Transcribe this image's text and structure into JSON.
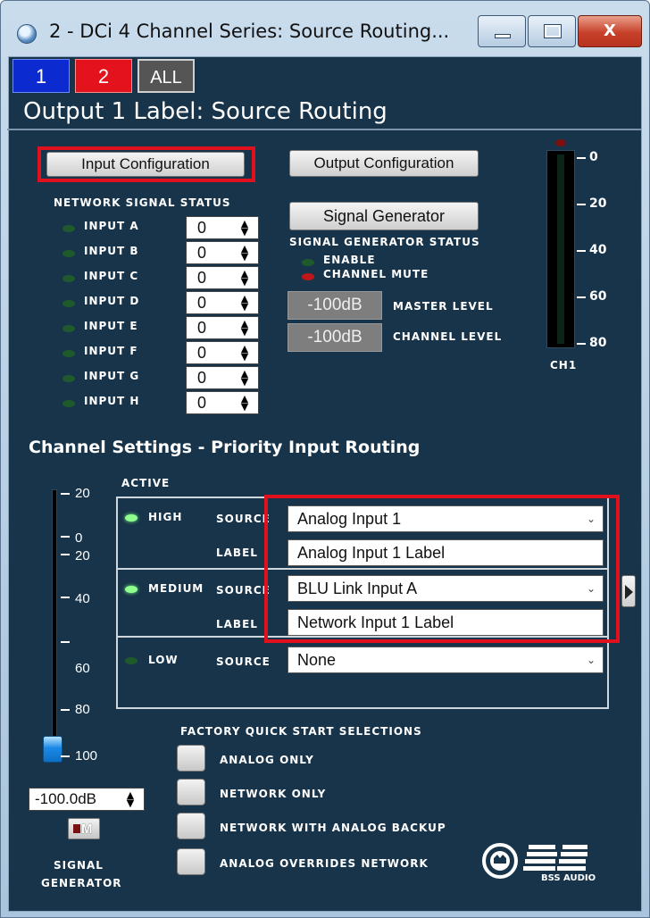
{
  "window": {
    "title": "2 - DCi 4 Channel Series: Source Routing..."
  },
  "tabs": [
    "1",
    "2",
    "ALL"
  ],
  "panel": {
    "title": "Output 1 Label: Source Routing"
  },
  "buttons": {
    "input_configuration": "Input Configuration",
    "output_configuration": "Output Configuration",
    "signal_generator": "Signal Generator"
  },
  "network_status": {
    "heading": "NETWORK SIGNAL STATUS",
    "inputs": [
      {
        "label": "INPUT A",
        "value": "0"
      },
      {
        "label": "INPUT B",
        "value": "0"
      },
      {
        "label": "INPUT C",
        "value": "0"
      },
      {
        "label": "INPUT D",
        "value": "0"
      },
      {
        "label": "INPUT E",
        "value": "0"
      },
      {
        "label": "INPUT F",
        "value": "0"
      },
      {
        "label": "INPUT G",
        "value": "0"
      },
      {
        "label": "INPUT H",
        "value": "0"
      }
    ]
  },
  "signal_generator_status": {
    "heading": "SIGNAL GENERATOR STATUS",
    "enable": "ENABLE",
    "channel_mute": "CHANNEL MUTE",
    "master_level_value": "-100dB",
    "master_level_label": "MASTER LEVEL",
    "channel_level_value": "-100dB",
    "channel_level_label": "CHANNEL LEVEL"
  },
  "meter": {
    "scale": [
      "0",
      "20",
      "40",
      "60",
      "80"
    ],
    "label": "CH1"
  },
  "channel_settings": {
    "heading": "Channel Settings - Priority Input Routing",
    "active_label": "ACTIVE",
    "source_label": "SOURCE",
    "label_label": "LABEL",
    "rows": [
      {
        "priority": "HIGH",
        "source": "Analog Input 1",
        "label": "Analog Input 1 Label",
        "active": true
      },
      {
        "priority": "MEDIUM",
        "source": "BLU Link Input A",
        "label": "Network Input 1 Label",
        "active": true
      },
      {
        "priority": "LOW",
        "source": "None",
        "active": false
      }
    ]
  },
  "slider": {
    "scale": [
      "20",
      "0",
      "20",
      "40",
      "60",
      "80",
      "100"
    ],
    "value": "-100.0dB",
    "mute_label": "M",
    "caption_line1": "SIGNAL",
    "caption_line2": "GENERATOR"
  },
  "factory_quick_start": {
    "heading": "FACTORY QUICK START SELECTIONS",
    "options": [
      "ANALOG ONLY",
      "NETWORK ONLY",
      "NETWORK WITH ANALOG BACKUP",
      "ANALOG OVERRIDES NETWORK"
    ]
  },
  "logo": {
    "text": "BSS AUDIO"
  },
  "colors": {
    "panel_bg": "#17344a",
    "highlight_red": "#e0101c",
    "tab_blue": "#0b2bd0",
    "tab_red": "#e4121c"
  }
}
